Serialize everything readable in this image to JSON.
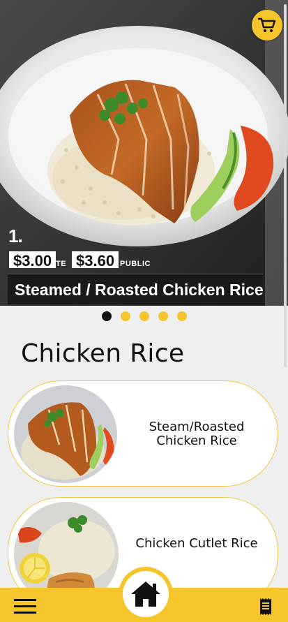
{
  "hero": {
    "item_number": "1.",
    "price_1": "$3.00",
    "price_1_suffix": "TE",
    "price_2": "$3.60",
    "price_2_suffix": "PUBLIC",
    "banner_text": "Steamed / Roasted Chicken Rice",
    "cart_icon": "cart-icon",
    "carousel_dots": 5,
    "active_dot": 0
  },
  "section": {
    "title": "Chicken Rice"
  },
  "menu": {
    "items": [
      {
        "label": "Steam/Roasted Chicken Rice"
      },
      {
        "label": "Chicken Cutlet Rice"
      }
    ]
  },
  "bottom_nav": {
    "left_icon": "hamburger-menu-icon",
    "center_icon": "home-icon",
    "right_icon": "receipt-icon"
  },
  "colors": {
    "accent": "#f6c52c",
    "card_border": "#f0c640",
    "background": "#efefef",
    "text": "#111111"
  }
}
